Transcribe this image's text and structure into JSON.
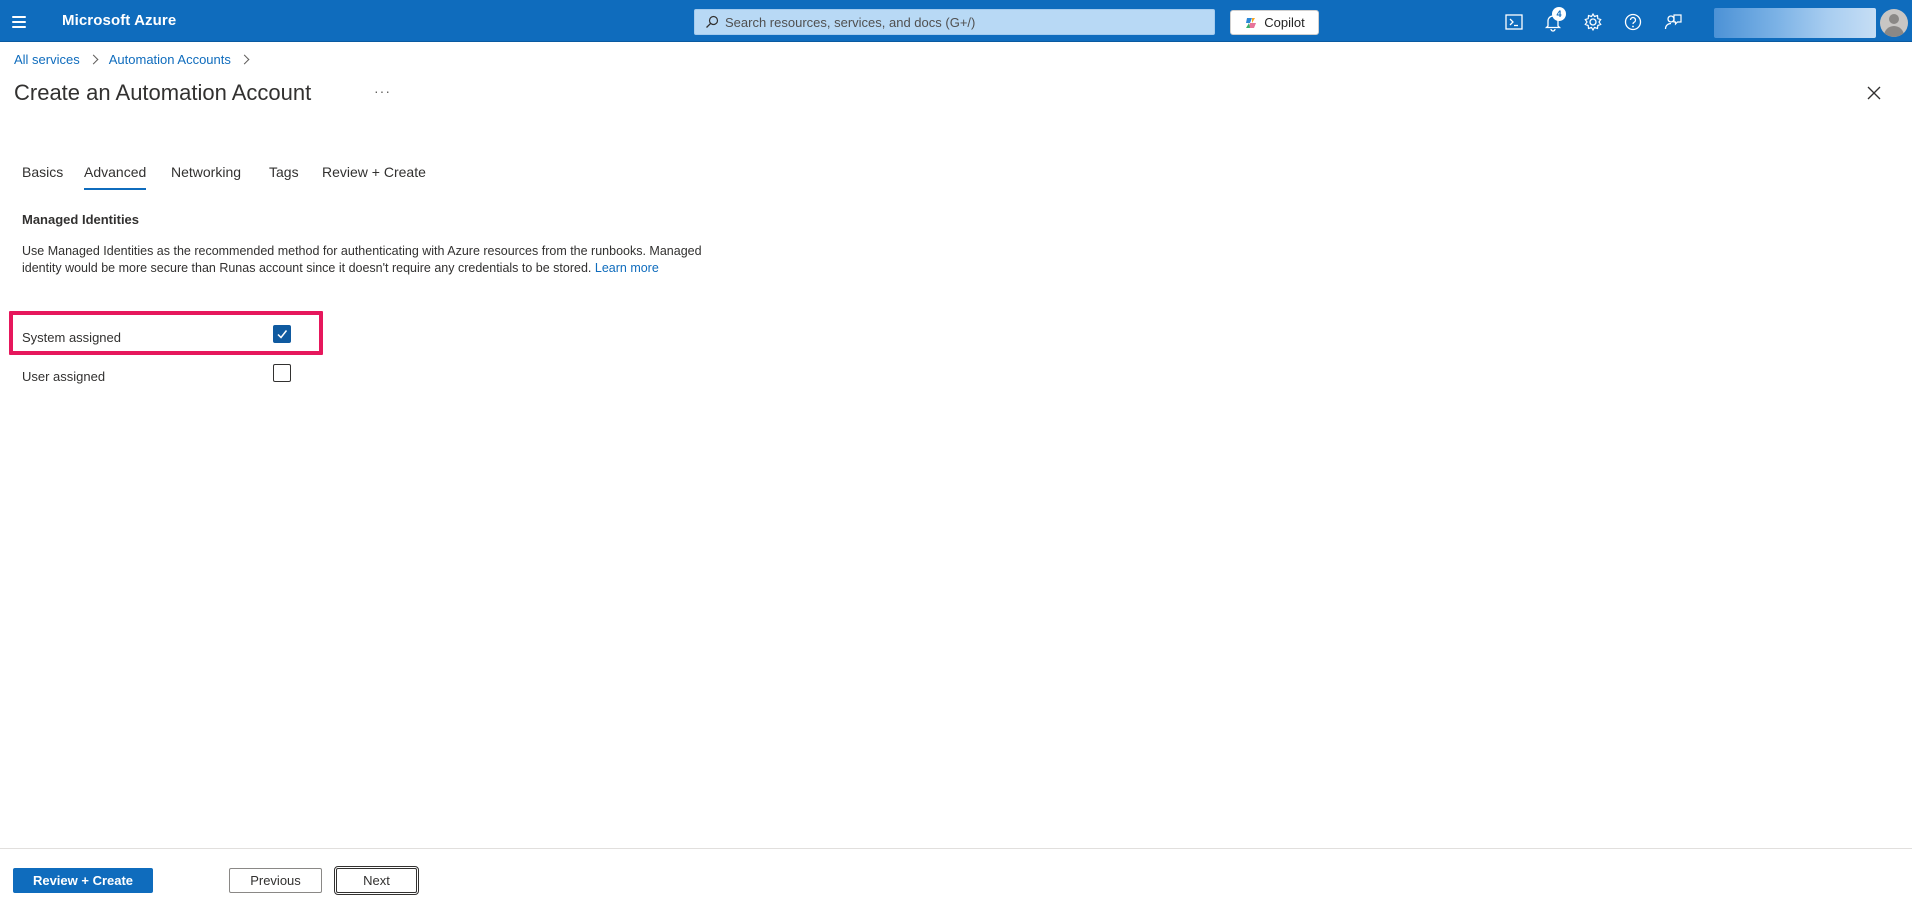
{
  "header": {
    "brand": "Microsoft Azure",
    "search_placeholder": "Search resources, services, and docs (G+/)",
    "copilot_label": "Copilot",
    "notification_count": "4",
    "bar_color": "#0f6cbd"
  },
  "breadcrumb": {
    "items": [
      "All services",
      "Automation Accounts"
    ]
  },
  "page": {
    "title": "Create an Automation Account",
    "more_label": "···"
  },
  "tabs": [
    {
      "label": "Basics",
      "active": false
    },
    {
      "label": "Advanced",
      "active": true
    },
    {
      "label": "Networking",
      "active": false
    },
    {
      "label": "Tags",
      "active": false
    },
    {
      "label": "Review + Create",
      "active": false
    }
  ],
  "managed_identities": {
    "section_title": "Managed Identities",
    "description": "Use Managed Identities as the recommended method for authenticating with Azure resources from the runbooks. Managed identity would be more secure than Runas account since it doesn't require any credentials to be stored.",
    "learn_more": "Learn more",
    "system_assigned": {
      "label": "System assigned",
      "checked": true
    },
    "user_assigned": {
      "label": "User assigned",
      "checked": false
    },
    "highlight_color": "#e6175c"
  },
  "footer": {
    "review_create_label": "Review + Create",
    "previous_label": "Previous",
    "next_label": "Next"
  }
}
